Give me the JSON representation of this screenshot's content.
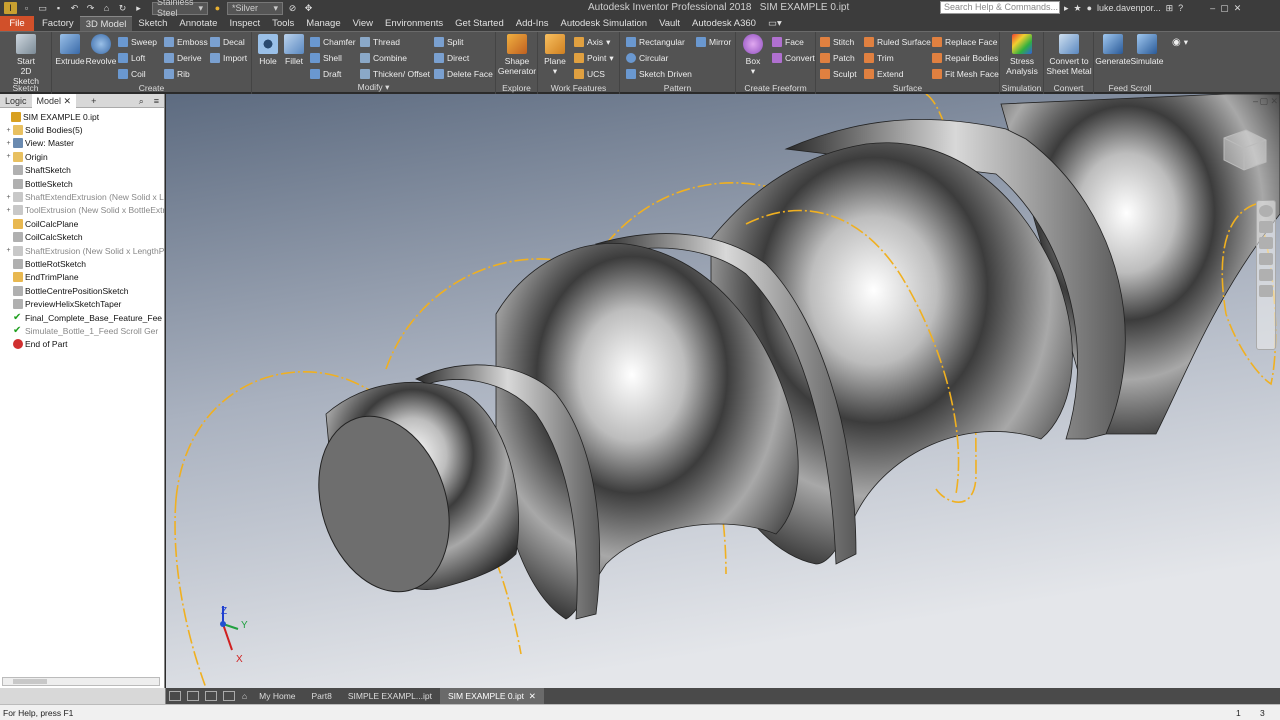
{
  "app": {
    "title": "Autodesk Inventor Professional 2018",
    "document": "SIM EXAMPLE 0.ipt"
  },
  "quickaccess": {
    "material": "Stainless Steel",
    "appearance": "*Silver"
  },
  "search": {
    "placeholder": "Search Help & Commands..."
  },
  "user": "luke.davenpor...",
  "menu": [
    {
      "label": "File"
    },
    {
      "label": "Factory"
    },
    {
      "label": "3D Model"
    },
    {
      "label": "Sketch"
    },
    {
      "label": "Annotate"
    },
    {
      "label": "Inspect"
    },
    {
      "label": "Tools"
    },
    {
      "label": "Manage"
    },
    {
      "label": "View"
    },
    {
      "label": "Environments"
    },
    {
      "label": "Get Started"
    },
    {
      "label": "Add-Ins"
    },
    {
      "label": "Autodesk Simulation"
    },
    {
      "label": "Vault"
    },
    {
      "label": "Autodesk A360"
    }
  ],
  "ribbon": {
    "sketch": {
      "label": "Sketch",
      "start": "Start",
      "start2": "2D Sketch"
    },
    "create": {
      "label": "Create",
      "extrude": "Extrude",
      "revolve": "Revolve",
      "sweep": "Sweep",
      "loft": "Loft",
      "coil": "Coil",
      "emboss": "Emboss",
      "derive": "Derive",
      "rib": "Rib",
      "decal": "Decal",
      "import": "Import"
    },
    "modify": {
      "label": "Modify",
      "hole": "Hole",
      "fillet": "Fillet",
      "chamfer": "Chamfer",
      "shell": "Shell",
      "draft": "Draft",
      "thread": "Thread",
      "combine": "Combine",
      "thicken": "Thicken/ Offset",
      "split": "Split",
      "direct": "Direct",
      "deleteface": "Delete Face"
    },
    "explore": {
      "label": "Explore",
      "shape": "Shape",
      "shape2": "Generator"
    },
    "work": {
      "label": "Work Features",
      "plane": "Plane",
      "axis": "Axis",
      "point": "Point",
      "ucs": "UCS"
    },
    "pattern": {
      "label": "Pattern",
      "rectangular": "Rectangular",
      "circular": "Circular",
      "sketchdriven": "Sketch Driven",
      "mirror": "Mirror"
    },
    "freeform": {
      "label": "Create Freeform",
      "box": "Box",
      "face": "Face",
      "convert": "Convert"
    },
    "surface": {
      "label": "Surface",
      "stitch": "Stitch",
      "patch": "Patch",
      "sculpt": "Sculpt",
      "ruled": "Ruled Surface",
      "trim": "Trim",
      "extend": "Extend",
      "replace": "Replace Face",
      "repair": "Repair Bodies",
      "fitmesh": "Fit Mesh Face"
    },
    "simulation": {
      "label": "Simulation",
      "stress": "Stress",
      "stress2": "Analysis"
    },
    "convert": {
      "label": "Convert",
      "cts": "Convert to",
      "cts2": "Sheet Metal"
    },
    "feedscroll": {
      "label": "Feed Scroll",
      "generate": "Generate",
      "simulate": "Simulate"
    }
  },
  "browser": {
    "tabs": [
      "Logic",
      "Model"
    ],
    "nodes": [
      {
        "label": "SIM EXAMPLE 0.ipt",
        "icon": "part-icon",
        "color": "#d8a020",
        "indent": 0,
        "exp": "",
        "dim": false
      },
      {
        "label": "Solid Bodies(5)",
        "icon": "folder-icon",
        "color": "#e8c060",
        "indent": 1,
        "exp": "+",
        "dim": false
      },
      {
        "label": "View: Master",
        "icon": "view-icon",
        "color": "#6a8ab0",
        "indent": 1,
        "exp": "+",
        "dim": false
      },
      {
        "label": "Origin",
        "icon": "folder-icon",
        "color": "#e8c060",
        "indent": 1,
        "exp": "+",
        "dim": false
      },
      {
        "label": "ShaftSketch",
        "icon": "sketch-icon",
        "color": "#b0b0b0",
        "indent": 1,
        "exp": "",
        "dim": false
      },
      {
        "label": "BottleSketch",
        "icon": "sketch-icon",
        "color": "#b0b0b0",
        "indent": 1,
        "exp": "",
        "dim": false
      },
      {
        "label": "ShaftExtendExtrusion (New Solid x Le",
        "icon": "extrusion-icon",
        "color": "#c8c8c8",
        "indent": 1,
        "exp": "+",
        "dim": true
      },
      {
        "label": "ToolExtrusion (New Solid x BottleExtr",
        "icon": "extrusion-icon",
        "color": "#c8c8c8",
        "indent": 1,
        "exp": "+",
        "dim": true
      },
      {
        "label": "CoilCalcPlane",
        "icon": "plane-icon",
        "color": "#e8b850",
        "indent": 1,
        "exp": "",
        "dim": false
      },
      {
        "label": "CoilCalcSketch",
        "icon": "sketch-icon",
        "color": "#b0b0b0",
        "indent": 1,
        "exp": "",
        "dim": false
      },
      {
        "label": "ShaftExtrusion (New Solid x LengthPr",
        "icon": "extrusion-icon",
        "color": "#c8c8c8",
        "indent": 1,
        "exp": "+",
        "dim": true
      },
      {
        "label": "BottleRotSketch",
        "icon": "sketch-icon",
        "color": "#b0b0b0",
        "indent": 1,
        "exp": "",
        "dim": false
      },
      {
        "label": "EndTrimPlane",
        "icon": "plane-icon",
        "color": "#e8b850",
        "indent": 1,
        "exp": "",
        "dim": false
      },
      {
        "label": "BottleCentrePositionSketch",
        "icon": "sketch-icon",
        "color": "#b0b0b0",
        "indent": 1,
        "exp": "",
        "dim": false
      },
      {
        "label": "PreviewHelixSketchTaper",
        "icon": "sketch-icon",
        "color": "#b0b0b0",
        "indent": 1,
        "exp": "",
        "dim": false
      },
      {
        "label": "Final_Complete_Base_Feature_Fee",
        "icon": "checkmark-icon",
        "color": "#e8c060",
        "indent": 1,
        "exp": "",
        "dim": false
      },
      {
        "label": "Simulate_Bottle_1_Feed Scroll Ger",
        "icon": "checkmark-icon",
        "color": "#c8c8c8",
        "indent": 1,
        "exp": "",
        "dim": true
      },
      {
        "label": "End of Part",
        "icon": "end-of-part-icon",
        "color": "#d03030",
        "indent": 1,
        "exp": "",
        "dim": false
      }
    ]
  },
  "doctabs": [
    "My Home",
    "Part8",
    "SIMPLE EXAMPL...ipt",
    "SIM EXAMPLE 0.ipt"
  ],
  "status": {
    "help": "For Help, press F1",
    "n1": "1",
    "n2": "3"
  },
  "axes": {
    "x": "X",
    "y": "Y",
    "z": "Z"
  },
  "colors": {
    "file_tab": "#d1502a",
    "helix": "#f0b020",
    "accent": "#3a78c8"
  }
}
